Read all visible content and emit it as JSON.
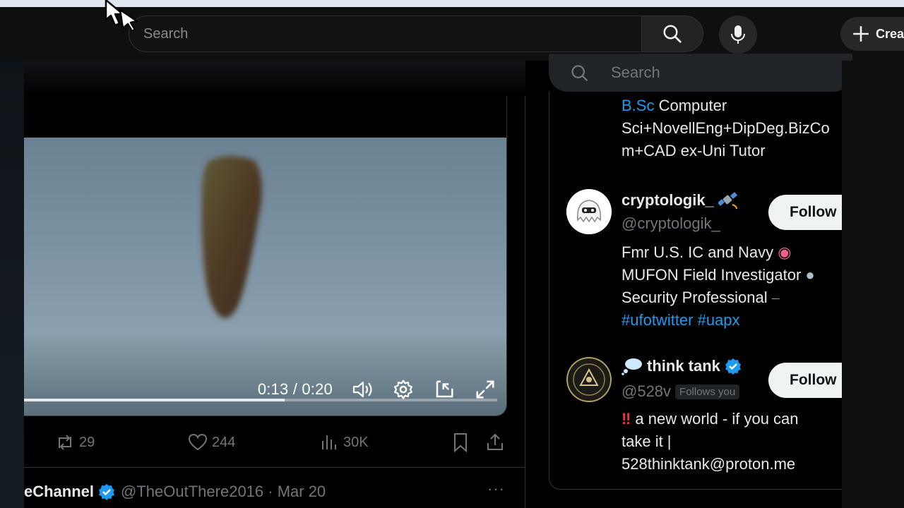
{
  "youtube": {
    "search_placeholder": "Search",
    "create_label": "Create"
  },
  "video": {
    "time": "0:13 / 0:20",
    "progress": 0.55
  },
  "tweet_actions": {
    "retweets": "29",
    "likes": "244",
    "views": "30K"
  },
  "next_tweet": {
    "name": "eChannel",
    "handle": "@TheOutThere2016 · Mar 20",
    "more": "···"
  },
  "sidebar": {
    "search_placeholder": "Search",
    "users": [
      {
        "bio_link": "B.Sc",
        "bio_line1": " Computer",
        "bio_line2": "Sci+NovellEng+DipDeg.BizCo",
        "bio_line3": "m+CAD ex-Uni Tutor"
      },
      {
        "name": "cryptologik_",
        "handle": "@cryptologik_",
        "follow_label": "Follow",
        "bio_line1": "Fmr U.S. IC and Navy",
        "bio_line2": "MUFON Field Investigator",
        "bio_line3": "Security Professional",
        "bio_tags": "#ufotwitter #uapx"
      },
      {
        "name": "think tank",
        "handle": "@528v",
        "follows_you": "Follows you",
        "follow_label": "Follow",
        "bio_line1": "a new world - if you can",
        "bio_line2": "take it |",
        "bio_line3": "528thinktank@proton.me"
      }
    ]
  },
  "colors": {
    "accent_blue": "#1d9bf0",
    "background": "#000000",
    "muted": "#71767b"
  }
}
